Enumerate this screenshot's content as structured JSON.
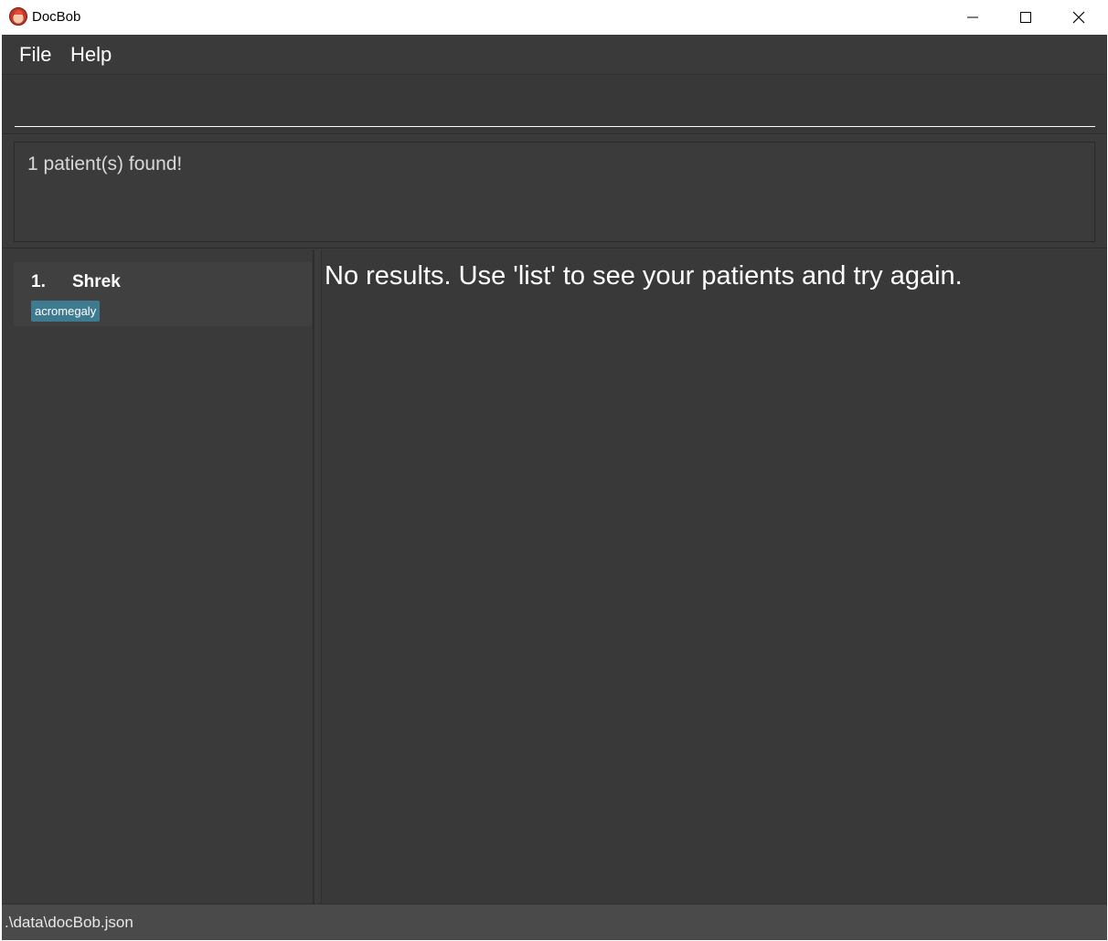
{
  "window": {
    "title": "DocBob",
    "controls": [
      "minimize-icon",
      "maximize-icon",
      "close-icon"
    ]
  },
  "menu": {
    "file_label": "File",
    "help_label": "Help"
  },
  "command": {
    "value": "",
    "placeholder": ""
  },
  "result": {
    "message": "1 patient(s) found!"
  },
  "patients": [
    {
      "index": "1.",
      "name": "Shrek",
      "tags": [
        "acromegaly"
      ]
    }
  ],
  "details": {
    "message": "No results. Use 'list' to see your patients and try again."
  },
  "status": {
    "file_path": ".\\data\\docBob.json"
  },
  "colors": {
    "background": "#3c3c3c",
    "tag": "#3e7b91",
    "text": "#ffffff"
  }
}
